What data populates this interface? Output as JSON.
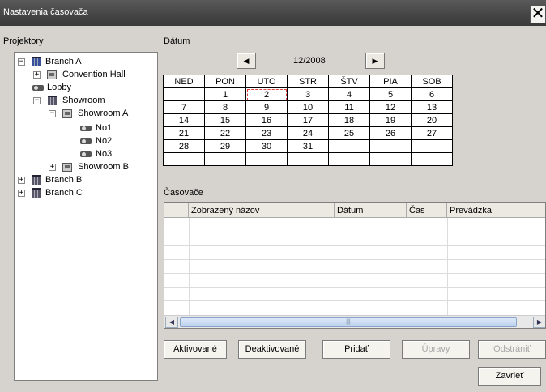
{
  "window": {
    "title": "Nastavenia časovača",
    "close_glyph": "✕"
  },
  "projectors": {
    "label": "Projektory",
    "tree": [
      {
        "label": "Branch A",
        "toggle": "−",
        "icon": "building-icon"
      },
      {
        "label": "Convention Hall",
        "toggle": "+",
        "icon": "room-icon"
      },
      {
        "label": "Lobby",
        "toggle": "",
        "icon": "projector-icon"
      },
      {
        "label": "Showroom",
        "toggle": "−",
        "icon": "building-icon"
      },
      {
        "label": "Showroom A",
        "toggle": "−",
        "icon": "room-icon"
      },
      {
        "label": "No1",
        "toggle": "",
        "icon": "projector-icon"
      },
      {
        "label": "No2",
        "toggle": "",
        "icon": "projector-icon"
      },
      {
        "label": "No3",
        "toggle": "",
        "icon": "projector-icon"
      },
      {
        "label": "Showroom B",
        "toggle": "+",
        "icon": "room-icon"
      },
      {
        "label": "Branch B",
        "toggle": "+",
        "icon": "building-icon"
      },
      {
        "label": "Branch C",
        "toggle": "+",
        "icon": "building-icon"
      }
    ]
  },
  "date": {
    "label": "Dátum",
    "month": "12/2008",
    "prev_glyph": "◀",
    "next_glyph": "▶",
    "weekdays": [
      "NED",
      "PON",
      "UTO",
      "STR",
      "ŠTV",
      "PIA",
      "SOB"
    ],
    "weeks": [
      [
        "",
        "1",
        "2",
        "3",
        "4",
        "5",
        "6"
      ],
      [
        "7",
        "8",
        "9",
        "10",
        "11",
        "12",
        "13"
      ],
      [
        "14",
        "15",
        "16",
        "17",
        "18",
        "19",
        "20"
      ],
      [
        "21",
        "22",
        "23",
        "24",
        "25",
        "26",
        "27"
      ],
      [
        "28",
        "29",
        "30",
        "31",
        "",
        "",
        ""
      ],
      [
        "",
        "",
        "",
        "",
        "",
        "",
        ""
      ]
    ],
    "selected": "2"
  },
  "timers": {
    "label": "Časovače",
    "columns": [
      "",
      "Zobrazený názov",
      "Dátum",
      "Čas",
      "Prevádzka"
    ],
    "rows": [],
    "scroll_left": "◀",
    "scroll_right": "▶",
    "scroll_grip": "|||"
  },
  "buttons": {
    "enabled": "Aktivované",
    "disabled": "Deaktivované",
    "add": "Pridať",
    "edit": "Úpravy",
    "delete": "Odstrániť",
    "close": "Zavrieť"
  }
}
